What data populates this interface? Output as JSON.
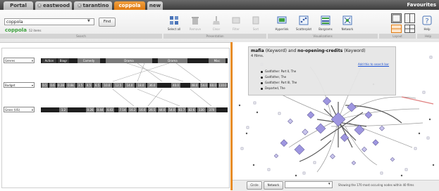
{
  "tabs": [
    {
      "label": "Portal",
      "active": false,
      "closable": false
    },
    {
      "label": "eastwood",
      "active": false,
      "closable": true
    },
    {
      "label": "tarantino",
      "active": false,
      "closable": true
    },
    {
      "label": "coppola",
      "active": true,
      "closable": true
    },
    {
      "label": "new",
      "active": false,
      "closable": false
    }
  ],
  "favourites": "Favourites",
  "search": {
    "value": "coppola",
    "find_label": "Find"
  },
  "context": {
    "name": "coppola",
    "count": "52 items"
  },
  "toolbar": {
    "group_labels": [
      "Search",
      "Presentation",
      "Visualizations",
      "Layout",
      "Help"
    ],
    "tools": [
      {
        "label": "Select all",
        "icon": "select-all-icon",
        "enabled": true
      },
      {
        "label": "Remove",
        "icon": "trash-icon",
        "enabled": false
      },
      {
        "label": "Clear",
        "icon": "broom-icon",
        "enabled": false
      },
      {
        "label": "Filter",
        "icon": "filter-icon",
        "enabled": false
      },
      {
        "label": "Sort",
        "icon": "sort-icon",
        "enabled": false
      },
      {
        "label": "Hyperlink",
        "icon": "hyperlink-icon",
        "enabled": true
      },
      {
        "label": "Scatterplot",
        "icon": "scatterplot-icon",
        "enabled": true
      },
      {
        "label": "Bargrams",
        "icon": "bargram-icon",
        "enabled": true
      },
      {
        "label": "Network",
        "icon": "network-icon",
        "enabled": true
      },
      {
        "label": "Help",
        "icon": "help-icon",
        "enabled": true
      }
    ]
  },
  "bargrams": [
    {
      "label": "Genres",
      "chips": [
        "Action",
        "Biogr",
        "",
        "Comedy",
        "",
        "Drama",
        "",
        "Drama",
        "",
        "Misc"
      ]
    },
    {
      "label": "Budget",
      "chips": [
        "0.5",
        "0.6",
        "0.28",
        "0.8k",
        "3.5",
        "4.5",
        "6.5",
        "10.0",
        "12.5",
        "14.0",
        "18.0",
        "36.0",
        "",
        "40.0",
        "",
        "48.0",
        "54.0",
        "60.0",
        "110.0"
      ]
    },
    {
      "label": "Gross (US)",
      "chips": [
        "1.2",
        "",
        "0.26",
        "0.44",
        "4.43",
        "7.14",
        "16.2",
        "16.0",
        "26.5",
        "44.0",
        "54.0",
        "61.7",
        "82.6",
        "130",
        "370"
      ]
    }
  ],
  "tooltip": {
    "keyword1": "mafia",
    "type1": "(Keyword)",
    "and": "and",
    "keyword2": "no-opening-credits",
    "type2": "(Keyword)",
    "count": "4 films.",
    "link": "Add this to search bar",
    "films": [
      "Godfather: Part II, The",
      "Godfather, The",
      "Godfather: Part III, The",
      "Departed, The"
    ]
  },
  "bottom": {
    "circle_label": "Circle",
    "network_label": "Network",
    "status": "Showing the 170 most occuring nodes within 40 films"
  }
}
